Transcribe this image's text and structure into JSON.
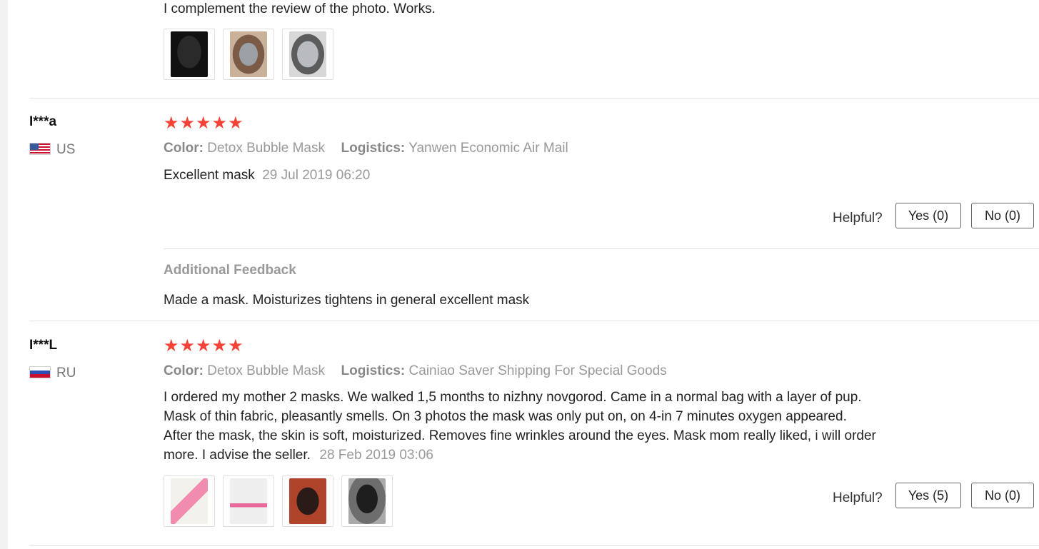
{
  "review0": {
    "text": "I complement the review of the photo. Works.",
    "photos": [
      "dark-mask-photo",
      "face-mask-photo",
      "bubble-mask-photo"
    ]
  },
  "review1": {
    "username": "I***a",
    "country": "US",
    "flag": "us-flag-icon",
    "rating": 5,
    "stars": "★★★★★",
    "color_label": "Color:",
    "color_value": "Detox Bubble Mask",
    "logistics_label": "Logistics:",
    "logistics_value": "Yanwen Economic Air Mail",
    "text": "Excellent mask",
    "date": "29 Jul 2019 06:20",
    "helpful_label": "Helpful?",
    "yes_label": "Yes (0)",
    "no_label": "No (0)",
    "additional_title": "Additional Feedback",
    "additional_text": "Made a mask. Moisturizes tightens in general excellent mask"
  },
  "review2": {
    "username": "I***L",
    "country": "RU",
    "flag": "ru-flag-icon",
    "rating": 5,
    "stars": "★★★★★",
    "color_label": "Color:",
    "color_value": "Detox Bubble Mask",
    "logistics_label": "Logistics:",
    "logistics_value": "Cainiao Saver Shipping For Special Goods",
    "text_lines": [
      "I ordered my mother 2 masks. We walked 1,5 months to nizhny novgorod. Came in a normal bag with a layer of pup.",
      "Mask of thin fabric, pleasantly smells. On 3 photos the mask was only put on, on 4-in 7 minutes oxygen appeared.",
      "After the mask, the skin is soft, moisturized. Removes fine wrinkles around the eyes. Mask mom really liked, i will order"
    ],
    "text_last": "more. I advise the seller.",
    "date": "28 Feb 2019 03:06",
    "helpful_label": "Helpful?",
    "yes_label": "Yes (5)",
    "no_label": "No (0)",
    "photos": [
      "mask-pack-photo",
      "mask-pack-photo",
      "dark-face-mask-photo",
      "oxygen-mask-photo"
    ]
  }
}
